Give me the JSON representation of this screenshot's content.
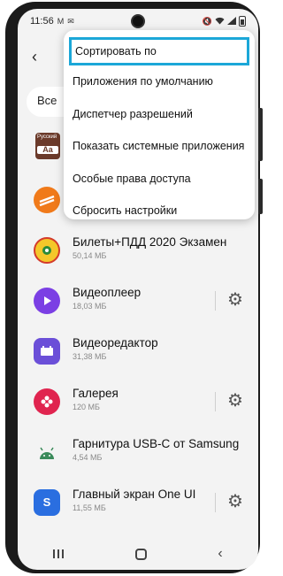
{
  "status_bar": {
    "time": "11:56",
    "indicators_left": [
      "M",
      "✉"
    ],
    "indicators_right": [
      "🔇",
      "Wi‑Fi",
      "signal"
    ]
  },
  "header": {
    "back_label": "‹",
    "filter_chip_label": "Все"
  },
  "menu": {
    "items": [
      {
        "label": "Сортировать по",
        "highlighted": true
      },
      {
        "label": "Приложения по умолчанию"
      },
      {
        "label": "Диспетчер разрешений"
      },
      {
        "label": "Показать системные приложения"
      },
      {
        "label": "Особые права доступа"
      },
      {
        "label": "Сбросить настройки"
      }
    ]
  },
  "dict_icon": {
    "top_text": "Русский",
    "bottom_text": "Aa"
  },
  "apps": [
    {
      "name": "",
      "size": "",
      "icon": "dictionary-icon"
    },
    {
      "name": "",
      "size": "",
      "icon": "road-icon"
    },
    {
      "name": "Билеты+ПДД 2020 Экзамен",
      "size": "50,14 МБ",
      "icon": "traffic-police-icon"
    },
    {
      "name": "Видеоплеер",
      "size": "18,03 МБ",
      "icon": "play-icon",
      "settings": true
    },
    {
      "name": "Видеоредактор",
      "size": "31,38 МБ",
      "icon": "video-editor-icon"
    },
    {
      "name": "Галерея",
      "size": "120 МБ",
      "icon": "gallery-flower-icon",
      "settings": true
    },
    {
      "name": "Гарнитура USB-C от Samsung",
      "size": "4,54 МБ",
      "icon": "android-icon"
    },
    {
      "name": "Главный экран One UI",
      "size": "11,55 МБ",
      "icon": "one-ui-home-icon",
      "settings": true
    }
  ],
  "colors": {
    "menu_highlight": "#1ba7d8",
    "video_player": "#7b3fe4",
    "video_editor": "#6b4fd8",
    "gallery": "#e0244f",
    "android": "#333333",
    "one_ui": "#2a6ee0",
    "road": "#f07a1a"
  }
}
